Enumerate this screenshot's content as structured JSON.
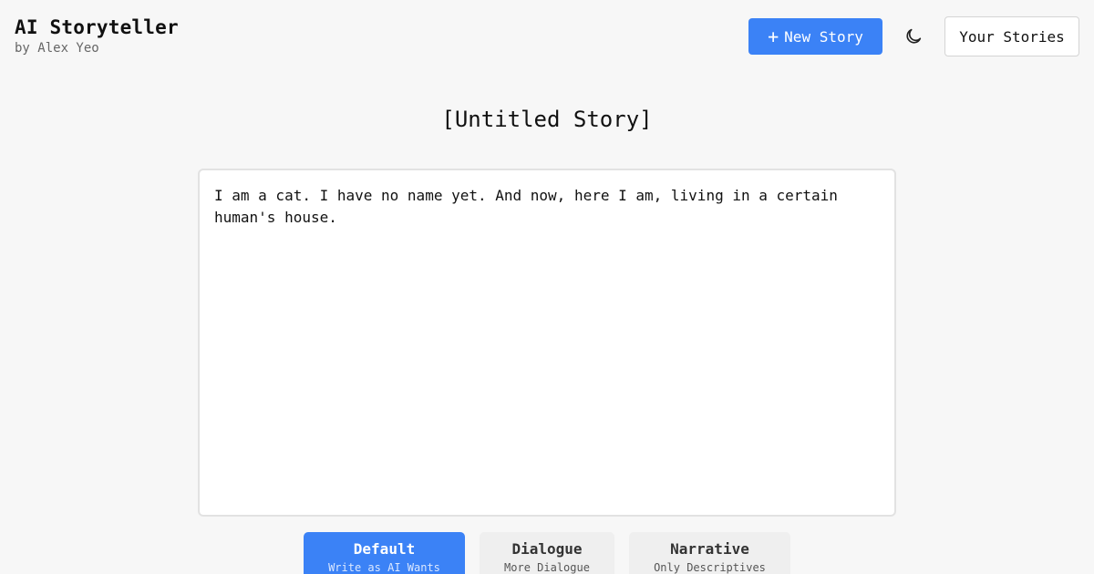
{
  "header": {
    "app_title": "AI Storyteller",
    "byline": "by Alex Yeo",
    "new_story_icon": "+",
    "new_story_label": "New Story",
    "theme_icon": "moon-icon",
    "your_stories_label": "Your Stories"
  },
  "story": {
    "title": "[Untitled Story]",
    "text": "I am a cat. I have no name yet. And now, here I am, living in a certain human's house."
  },
  "modes": [
    {
      "label": "Default",
      "sub": "Write as AI Wants",
      "active": true
    },
    {
      "label": "Dialogue",
      "sub": "More Dialogue",
      "active": false
    },
    {
      "label": "Narrative",
      "sub": "Only Descriptives",
      "active": false
    }
  ],
  "colors": {
    "accent": "#3b82f6",
    "background": "#f7f7f7"
  }
}
